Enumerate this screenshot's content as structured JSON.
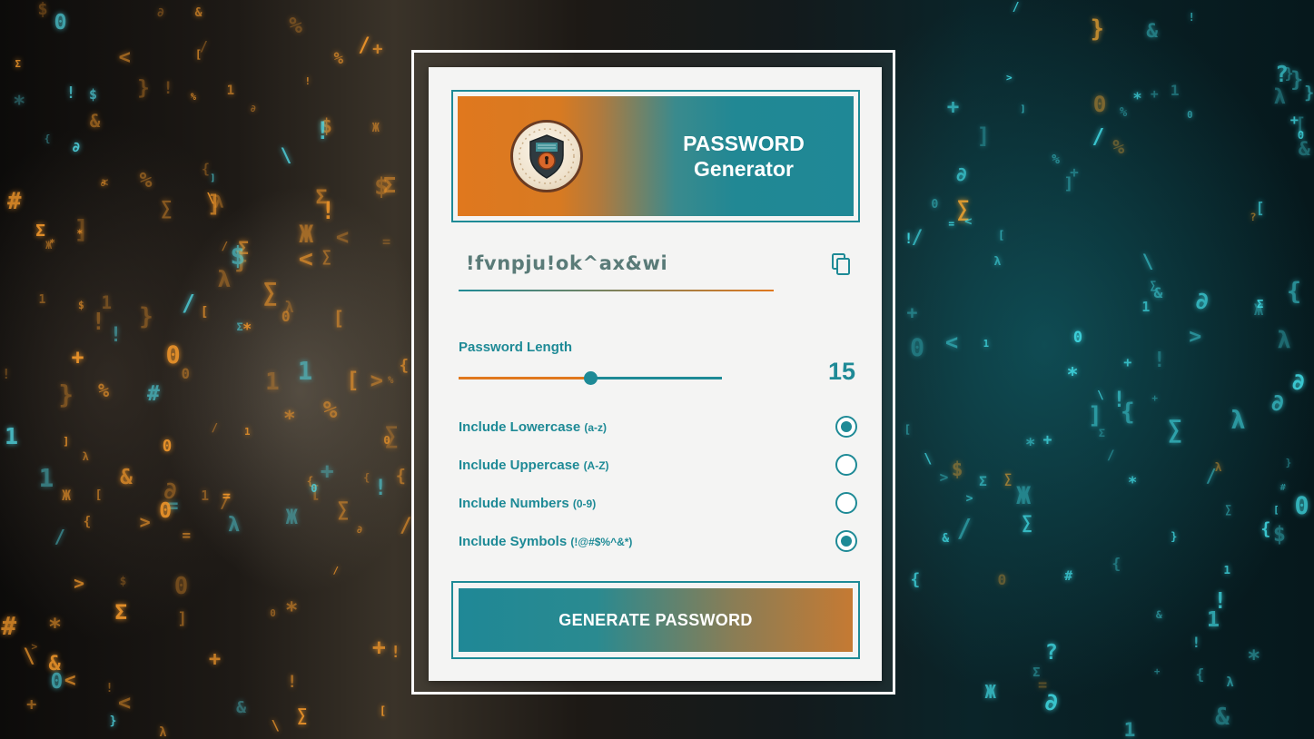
{
  "header": {
    "title_line1": "PASSWORD",
    "title_line2": "Generator",
    "logo_icon": "shield-lock-icon"
  },
  "password": {
    "value": "!fvnpju!ok^ax&wi",
    "copy_icon": "copy-icon"
  },
  "length": {
    "label": "Password Length",
    "value": "15",
    "fraction": 0.5
  },
  "options": [
    {
      "label": "Include Lowercase",
      "hint": "(a-z)",
      "checked": true
    },
    {
      "label": "Include Uppercase",
      "hint": "(A-Z)",
      "checked": false
    },
    {
      "label": "Include Numbers",
      "hint": "(0-9)",
      "checked": false
    },
    {
      "label": "Include Symbols",
      "hint": "(!@#$%^&*)",
      "checked": true
    }
  ],
  "generate_button": {
    "label": "GENERATE PASSWORD"
  },
  "colors": {
    "accent_teal": "#1e8a96",
    "accent_orange": "#e0781e"
  }
}
